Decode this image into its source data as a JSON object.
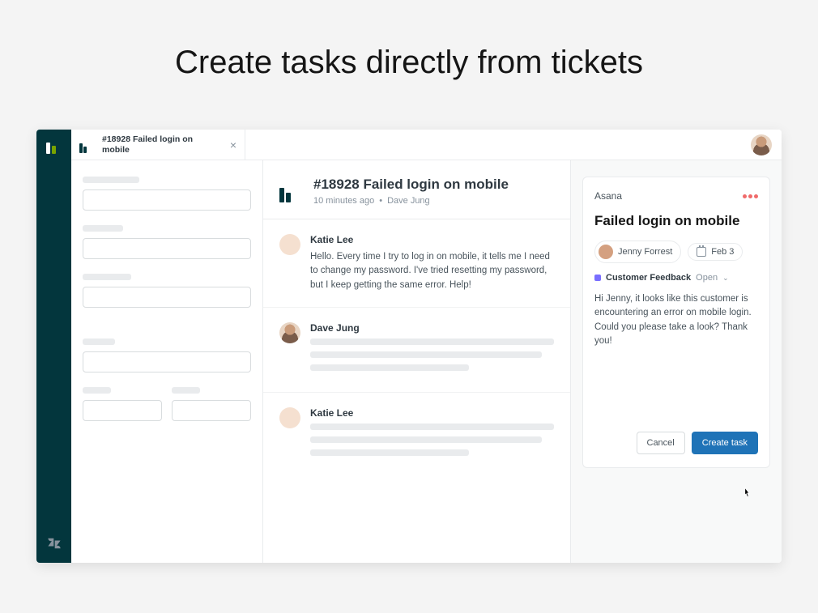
{
  "page_heading": "Create tasks directly from tickets",
  "tab": {
    "title": "#18928 Failed login on mobile"
  },
  "ticket": {
    "title": "#18928 Failed login on mobile",
    "time_ago": "10 minutes ago",
    "requester": "Dave Jung"
  },
  "messages": [
    {
      "author": "Katie Lee",
      "text": "Hello. Every time I try to log in on mobile, it tells me I need to change my password. I've tried resetting my password, but I keep getting the same error. Help!"
    },
    {
      "author": "Dave Jung",
      "text": ""
    },
    {
      "author": "Katie Lee",
      "text": ""
    }
  ],
  "asana": {
    "app_name": "Asana",
    "task_title": "Failed login on mobile",
    "assignee": "Jenny Forrest",
    "due_date": "Feb 3",
    "project": "Customer Feedback",
    "status": "Open",
    "description": "Hi Jenny, it looks like this customer is encountering an error on mobile login. Could you please take a look? Thank you!",
    "cancel_label": "Cancel",
    "create_label": "Create task"
  }
}
